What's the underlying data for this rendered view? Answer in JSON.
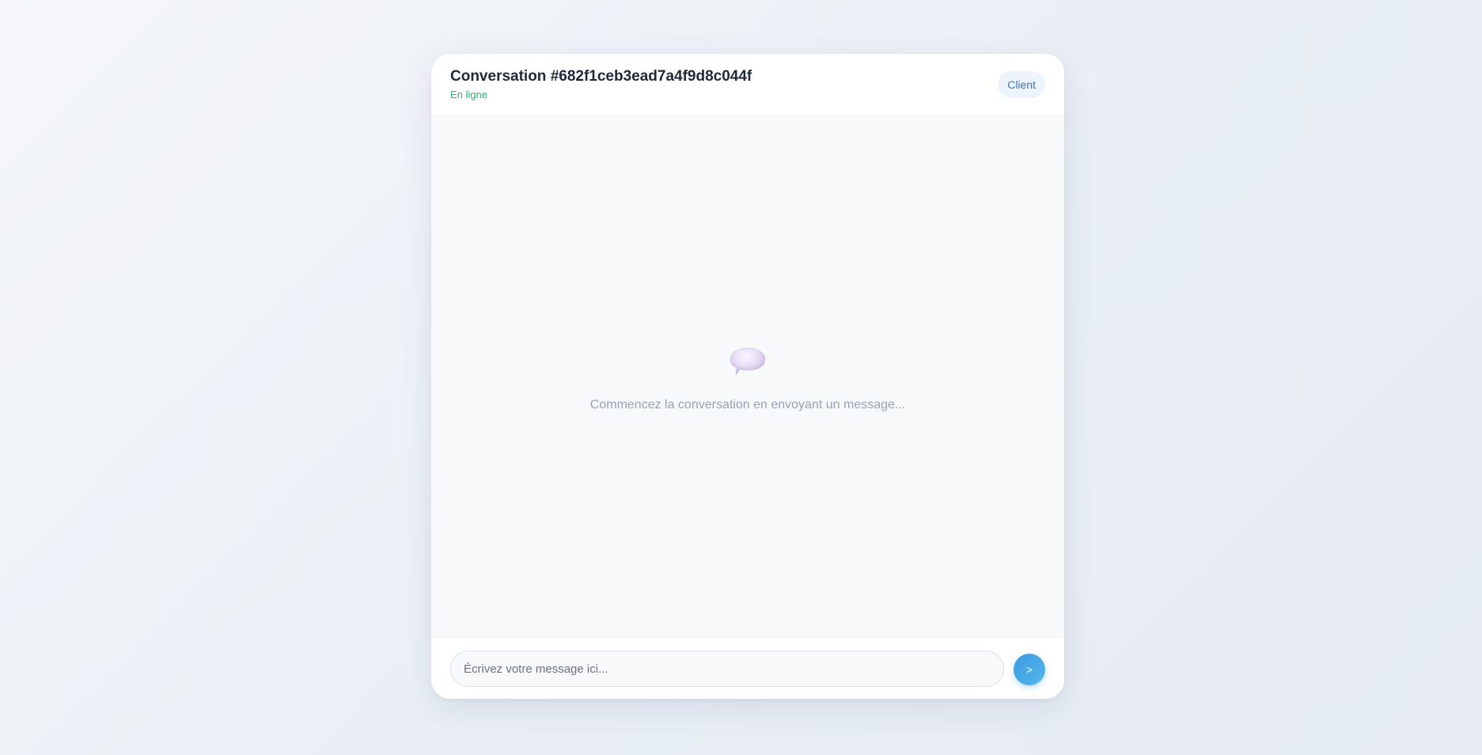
{
  "chat": {
    "title": "Conversation #682f1ceb3ead7a4f9d8c044f",
    "status": "En ligne",
    "role_badge": "Client",
    "empty_state": {
      "icon": "speech-bubble-icon",
      "text": "Commencez la conversation en envoyant un message..."
    },
    "composer": {
      "placeholder": "Écrivez votre message ici...",
      "value": "",
      "send_label": ">"
    }
  },
  "colors": {
    "status_online": "#22b573",
    "badge_text": "#3a78b8",
    "badge_bg": "#eef4fb",
    "send_button": "#3b9ae0",
    "empty_text": "#94a3b8"
  }
}
